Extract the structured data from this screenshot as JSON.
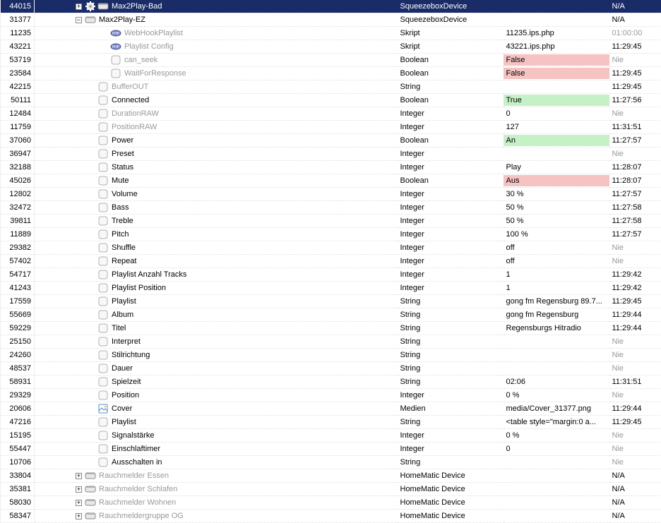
{
  "rows": [
    {
      "id": 44015,
      "depth": 3,
      "exp": "collapsed",
      "icon": "dev-sel",
      "name": "Max2Play-Bad",
      "dim": false,
      "type": "SqueezeboxDevice",
      "value": "",
      "bg": "",
      "time": "N/A",
      "tdim": false,
      "selected": true
    },
    {
      "id": 31377,
      "depth": 3,
      "exp": "expanded",
      "icon": "dev",
      "name": "Max2Play-EZ",
      "dim": false,
      "type": "SqueezeboxDevice",
      "value": "",
      "bg": "",
      "time": "N/A",
      "tdim": false,
      "selected": false
    },
    {
      "id": 11235,
      "depth": 5,
      "exp": "none",
      "icon": "php",
      "name": "WebHookPlaylist",
      "dim": true,
      "type": "Skript",
      "value": "11235.ips.php",
      "bg": "",
      "time": "01:00:00",
      "tdim": true,
      "selected": false
    },
    {
      "id": 43221,
      "depth": 5,
      "exp": "none",
      "icon": "php",
      "name": "Playlist Config",
      "dim": true,
      "type": "Skript",
      "value": "43221.ips.php",
      "bg": "",
      "time": "11:29:45",
      "tdim": false,
      "selected": false
    },
    {
      "id": 53719,
      "depth": 5,
      "exp": "none",
      "icon": "var",
      "name": "can_seek",
      "dim": true,
      "type": "Boolean",
      "value": "False",
      "bg": "red",
      "time": "Nie",
      "tdim": true,
      "selected": false
    },
    {
      "id": 23584,
      "depth": 5,
      "exp": "none",
      "icon": "var",
      "name": "WaitForResponse",
      "dim": true,
      "type": "Boolean",
      "value": "False",
      "bg": "red",
      "time": "11:29:45",
      "tdim": false,
      "selected": false
    },
    {
      "id": 42215,
      "depth": 4,
      "exp": "none",
      "icon": "var",
      "name": "BufferOUT",
      "dim": true,
      "type": "String",
      "value": "",
      "bg": "",
      "time": "11:29:45",
      "tdim": false,
      "selected": false
    },
    {
      "id": 50111,
      "depth": 4,
      "exp": "none",
      "icon": "var",
      "name": "Connected",
      "dim": false,
      "type": "Boolean",
      "value": "True",
      "bg": "green",
      "time": "11:27:56",
      "tdim": false,
      "selected": false
    },
    {
      "id": 12484,
      "depth": 4,
      "exp": "none",
      "icon": "var",
      "name": "DurationRAW",
      "dim": true,
      "type": "Integer",
      "value": "0",
      "bg": "",
      "time": "Nie",
      "tdim": true,
      "selected": false
    },
    {
      "id": 11759,
      "depth": 4,
      "exp": "none",
      "icon": "var",
      "name": "PositionRAW",
      "dim": true,
      "type": "Integer",
      "value": "127",
      "bg": "",
      "time": "11:31:51",
      "tdim": false,
      "selected": false
    },
    {
      "id": 37060,
      "depth": 4,
      "exp": "none",
      "icon": "var",
      "name": "Power",
      "dim": false,
      "type": "Boolean",
      "value": "An",
      "bg": "green",
      "time": "11:27:57",
      "tdim": false,
      "selected": false
    },
    {
      "id": 36947,
      "depth": 4,
      "exp": "none",
      "icon": "var",
      "name": "Preset",
      "dim": false,
      "type": "Integer",
      "value": "",
      "bg": "",
      "time": "Nie",
      "tdim": true,
      "selected": false
    },
    {
      "id": 32188,
      "depth": 4,
      "exp": "none",
      "icon": "var",
      "name": "Status",
      "dim": false,
      "type": "Integer",
      "value": "Play",
      "bg": "",
      "time": "11:28:07",
      "tdim": false,
      "selected": false
    },
    {
      "id": 45026,
      "depth": 4,
      "exp": "none",
      "icon": "var",
      "name": "Mute",
      "dim": false,
      "type": "Boolean",
      "value": "Aus",
      "bg": "red",
      "time": "11:28:07",
      "tdim": false,
      "selected": false
    },
    {
      "id": 12802,
      "depth": 4,
      "exp": "none",
      "icon": "var",
      "name": "Volume",
      "dim": false,
      "type": "Integer",
      "value": "30 %",
      "bg": "",
      "time": "11:27:57",
      "tdim": false,
      "selected": false
    },
    {
      "id": 32472,
      "depth": 4,
      "exp": "none",
      "icon": "var",
      "name": "Bass",
      "dim": false,
      "type": "Integer",
      "value": "50 %",
      "bg": "",
      "time": "11:27:58",
      "tdim": false,
      "selected": false
    },
    {
      "id": 39811,
      "depth": 4,
      "exp": "none",
      "icon": "var",
      "name": "Treble",
      "dim": false,
      "type": "Integer",
      "value": "50 %",
      "bg": "",
      "time": "11:27:58",
      "tdim": false,
      "selected": false
    },
    {
      "id": 11889,
      "depth": 4,
      "exp": "none",
      "icon": "var",
      "name": "Pitch",
      "dim": false,
      "type": "Integer",
      "value": "100 %",
      "bg": "",
      "time": "11:27:57",
      "tdim": false,
      "selected": false
    },
    {
      "id": 29382,
      "depth": 4,
      "exp": "none",
      "icon": "var",
      "name": "Shuffle",
      "dim": false,
      "type": "Integer",
      "value": "off",
      "bg": "",
      "time": "Nie",
      "tdim": true,
      "selected": false
    },
    {
      "id": 57402,
      "depth": 4,
      "exp": "none",
      "icon": "var",
      "name": "Repeat",
      "dim": false,
      "type": "Integer",
      "value": "off",
      "bg": "",
      "time": "Nie",
      "tdim": true,
      "selected": false
    },
    {
      "id": 54717,
      "depth": 4,
      "exp": "none",
      "icon": "var",
      "name": "Playlist Anzahl Tracks",
      "dim": false,
      "type": "Integer",
      "value": "1",
      "bg": "",
      "time": "11:29:42",
      "tdim": false,
      "selected": false
    },
    {
      "id": 41243,
      "depth": 4,
      "exp": "none",
      "icon": "var",
      "name": "Playlist Position",
      "dim": false,
      "type": "Integer",
      "value": "1",
      "bg": "",
      "time": "11:29:42",
      "tdim": false,
      "selected": false
    },
    {
      "id": 17559,
      "depth": 4,
      "exp": "none",
      "icon": "var",
      "name": "Playlist",
      "dim": false,
      "type": "String",
      "value": "gong fm Regensburg 89.7...",
      "bg": "",
      "time": "11:29:45",
      "tdim": false,
      "selected": false
    },
    {
      "id": 55669,
      "depth": 4,
      "exp": "none",
      "icon": "var",
      "name": "Album",
      "dim": false,
      "type": "String",
      "value": "gong fm Regensburg",
      "bg": "",
      "time": "11:29:44",
      "tdim": false,
      "selected": false
    },
    {
      "id": 59229,
      "depth": 4,
      "exp": "none",
      "icon": "var",
      "name": "Titel",
      "dim": false,
      "type": "String",
      "value": "Regensburgs Hitradio",
      "bg": "",
      "time": "11:29:44",
      "tdim": false,
      "selected": false
    },
    {
      "id": 25150,
      "depth": 4,
      "exp": "none",
      "icon": "var",
      "name": "Interpret",
      "dim": false,
      "type": "String",
      "value": "",
      "bg": "",
      "time": "Nie",
      "tdim": true,
      "selected": false
    },
    {
      "id": 24260,
      "depth": 4,
      "exp": "none",
      "icon": "var",
      "name": "Stilrichtung",
      "dim": false,
      "type": "String",
      "value": "",
      "bg": "",
      "time": "Nie",
      "tdim": true,
      "selected": false
    },
    {
      "id": 48537,
      "depth": 4,
      "exp": "none",
      "icon": "var",
      "name": "Dauer",
      "dim": false,
      "type": "String",
      "value": "",
      "bg": "",
      "time": "Nie",
      "tdim": true,
      "selected": false
    },
    {
      "id": 58931,
      "depth": 4,
      "exp": "none",
      "icon": "var",
      "name": "Spielzeit",
      "dim": false,
      "type": "String",
      "value": "02:06",
      "bg": "",
      "time": "11:31:51",
      "tdim": false,
      "selected": false
    },
    {
      "id": 29329,
      "depth": 4,
      "exp": "none",
      "icon": "var",
      "name": "Position",
      "dim": false,
      "type": "Integer",
      "value": "0 %",
      "bg": "",
      "time": "Nie",
      "tdim": true,
      "selected": false
    },
    {
      "id": 20606,
      "depth": 4,
      "exp": "none",
      "icon": "media",
      "name": "Cover",
      "dim": false,
      "type": "Medien",
      "value": "media/Cover_31377.png",
      "bg": "",
      "time": "11:29:44",
      "tdim": false,
      "selected": false
    },
    {
      "id": 47216,
      "depth": 4,
      "exp": "none",
      "icon": "var",
      "name": "Playlist",
      "dim": false,
      "type": "String",
      "value": "<table style=\"margin:0 a...",
      "bg": "",
      "time": "11:29:45",
      "tdim": false,
      "selected": false
    },
    {
      "id": 15195,
      "depth": 4,
      "exp": "none",
      "icon": "var",
      "name": "Signalstärke",
      "dim": false,
      "type": "Integer",
      "value": "0 %",
      "bg": "",
      "time": "Nie",
      "tdim": true,
      "selected": false
    },
    {
      "id": 55447,
      "depth": 4,
      "exp": "none",
      "icon": "var",
      "name": "Einschlaftimer",
      "dim": false,
      "type": "Integer",
      "value": "0",
      "bg": "",
      "time": "Nie",
      "tdim": true,
      "selected": false
    },
    {
      "id": 10706,
      "depth": 4,
      "exp": "none",
      "icon": "var",
      "name": "Ausschalten in",
      "dim": false,
      "type": "String",
      "value": "",
      "bg": "",
      "time": "Nie",
      "tdim": true,
      "selected": false
    },
    {
      "id": 33804,
      "depth": 3,
      "exp": "collapsed",
      "icon": "dev",
      "name": "Rauchmelder Essen",
      "dim": true,
      "type": "HomeMatic Device",
      "value": "",
      "bg": "",
      "time": "N/A",
      "tdim": false,
      "selected": false
    },
    {
      "id": 35381,
      "depth": 3,
      "exp": "collapsed",
      "icon": "dev",
      "name": "Rauchmelder Schlafen",
      "dim": true,
      "type": "HomeMatic Device",
      "value": "",
      "bg": "",
      "time": "N/A",
      "tdim": false,
      "selected": false
    },
    {
      "id": 58030,
      "depth": 3,
      "exp": "collapsed",
      "icon": "dev",
      "name": "Rauchmelder Wohnen",
      "dim": true,
      "type": "HomeMatic Device",
      "value": "",
      "bg": "",
      "time": "N/A",
      "tdim": false,
      "selected": false
    },
    {
      "id": 58347,
      "depth": 3,
      "exp": "collapsed",
      "icon": "dev",
      "name": "Rauchmeldergruppe OG",
      "dim": true,
      "type": "HomeMatic Device",
      "value": "",
      "bg": "",
      "time": "N/A",
      "tdim": false,
      "selected": false
    }
  ]
}
